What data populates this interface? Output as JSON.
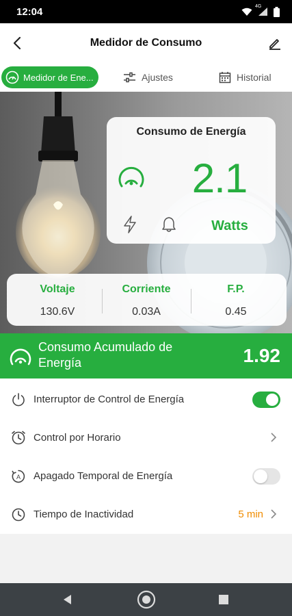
{
  "status_bar": {
    "time": "12:04",
    "network_label": "4G"
  },
  "header": {
    "title": "Medidor de Consumo",
    "back_icon": "chevron-left-icon",
    "edit_icon": "pencil-icon"
  },
  "tabs": [
    {
      "label": "Medidor de Ene...",
      "icon": "gauge-icon",
      "active": true
    },
    {
      "label": "Ajustes",
      "icon": "sliders-icon",
      "active": false
    },
    {
      "label": "Historial",
      "icon": "calendar-icon",
      "active": false
    }
  ],
  "energy_card": {
    "title": "Consumo de Energía",
    "value": "2.1",
    "unit": "Watts"
  },
  "metrics": [
    {
      "label": "Voltaje",
      "value": "130.6V"
    },
    {
      "label": "Corriente",
      "value": "0.03A"
    },
    {
      "label": "F.P.",
      "value": "0.45"
    }
  ],
  "accumulated": {
    "label": "Consumo Acumulado de Energía",
    "value": "1.92"
  },
  "settings": [
    {
      "label": "Interruptor de Control de Energía",
      "icon": "power-icon",
      "control": "toggle",
      "on": true
    },
    {
      "label": "Control por Horario",
      "icon": "clock-icon",
      "control": "chevron"
    },
    {
      "label": "Apagado Temporal de Energía",
      "icon": "timer-icon",
      "control": "toggle",
      "on": false
    },
    {
      "label": "Tiempo de Inactividad",
      "icon": "clock-icon",
      "control": "chevron",
      "value": "5 min"
    }
  ],
  "colors": {
    "accent": "#27ae3f",
    "value_orange": "#f08c00"
  }
}
